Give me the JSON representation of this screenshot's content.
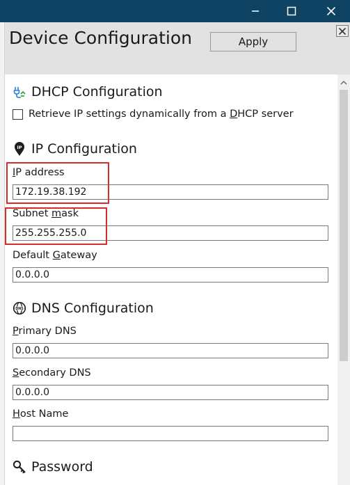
{
  "window": {
    "controls": {
      "minimize_icon": "minimize-icon",
      "maximize_icon": "maximize-icon",
      "close_icon": "close-icon"
    }
  },
  "header": {
    "title": "Device Configuration",
    "apply_label": "Apply"
  },
  "dhcp": {
    "title": "DHCP Configuration",
    "icon": "dhcp-plug-icon",
    "checkbox_pre": "Retrieve IP settings dynamically from a ",
    "checkbox_key": "D",
    "checkbox_post": "HCP server",
    "checked": false
  },
  "ip": {
    "title": "IP Configuration",
    "icon": "ip-pin-icon",
    "address": {
      "key": "I",
      "rest": "P address",
      "value": "172.19.38.192"
    },
    "subnet": {
      "pre": "Subnet ",
      "key": "m",
      "rest": "ask",
      "value": "255.255.255.0"
    },
    "gateway": {
      "pre": "Default ",
      "key": "G",
      "rest": "ateway",
      "value": "0.0.0.0"
    }
  },
  "dns": {
    "title": "DNS Configuration",
    "icon": "dns-globe-icon",
    "primary": {
      "key": "P",
      "rest": "rimary DNS",
      "value": "0.0.0.0"
    },
    "secondary": {
      "key": "S",
      "rest": "econdary DNS",
      "value": "0.0.0.0"
    },
    "host": {
      "key": "H",
      "rest": "ost Name",
      "value": ""
    }
  },
  "password": {
    "title": "Password",
    "icon": "key-icon"
  },
  "colors": {
    "titlebar": "#0e4263",
    "header": "#e2e2e2",
    "highlight": "#d92b2b"
  }
}
